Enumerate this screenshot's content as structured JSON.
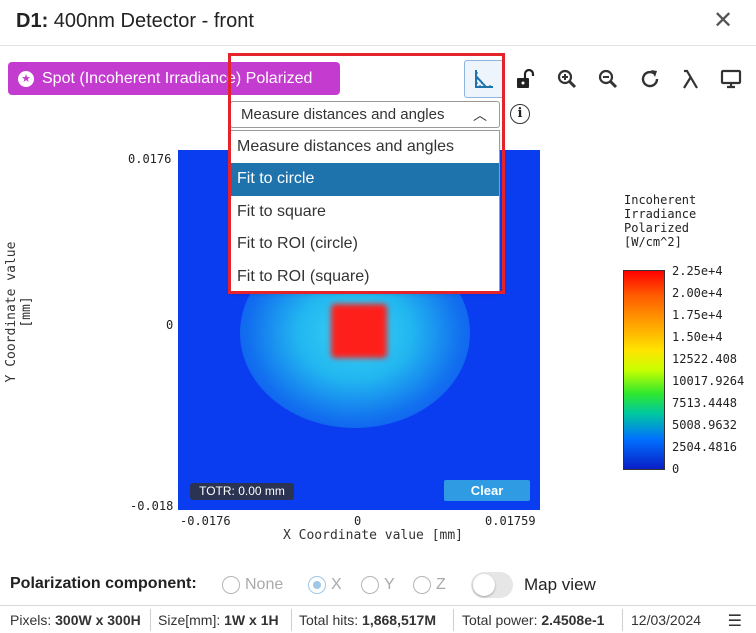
{
  "window": {
    "title_prefix": "D1:",
    "title": " 400nm Detector - front",
    "close_glyph": "✕"
  },
  "toolbar": {
    "spot_icon": "star-icon",
    "spot_label": "Spot (Incoherent Irradiance) Polarized",
    "tools": [
      "measure-icon",
      "unlock-icon",
      "zoom-in-icon",
      "zoom-out-icon",
      "refresh-icon",
      "lambda-icon",
      "monitor-icon"
    ],
    "accent_color": "#c43ccf"
  },
  "measure": {
    "selected": "Measure distances and angles",
    "options": [
      "Measure distances and angles",
      "Fit to circle",
      "Fit to square",
      "Fit to ROI (circle)",
      "Fit to ROI (square)"
    ],
    "highlighted": "Fit to circle"
  },
  "plot": {
    "y_ticks": [
      "0.0176",
      "0",
      "-0.018"
    ],
    "x_ticks": [
      "-0.0176",
      "0",
      "0.01759"
    ],
    "x_label": "X Coordinate value [mm]",
    "y_label": "Y Coordinate value [mm]",
    "totr": "TOTR: 0.00 mm",
    "clear_label": "Clear"
  },
  "colorbar": {
    "title": "Incoherent\nIrradiance\nPolarized\n[W/cm^2]",
    "ticks": [
      "2.25e+4",
      "2.00e+4",
      "1.75e+4",
      "1.50e+4",
      "12522.408",
      "10017.9264",
      "7513.4448",
      "5008.9632",
      "2504.4816",
      "0"
    ]
  },
  "polarization": {
    "label": "Polarization component:",
    "options": [
      "None",
      "X",
      "Y",
      "Z"
    ],
    "selected": "X",
    "map_view_label": "Map view"
  },
  "status": {
    "pixels_label": "Pixels:",
    "pixels_value": "300W x 300H",
    "size_label": "Size[mm]:",
    "size_value": "1W x 1H",
    "hits_label": "Total hits:",
    "hits_value": "1,868,517M",
    "power_label": "Total power:",
    "power_value": "2.4508e-1",
    "date": "12/03/2024"
  }
}
